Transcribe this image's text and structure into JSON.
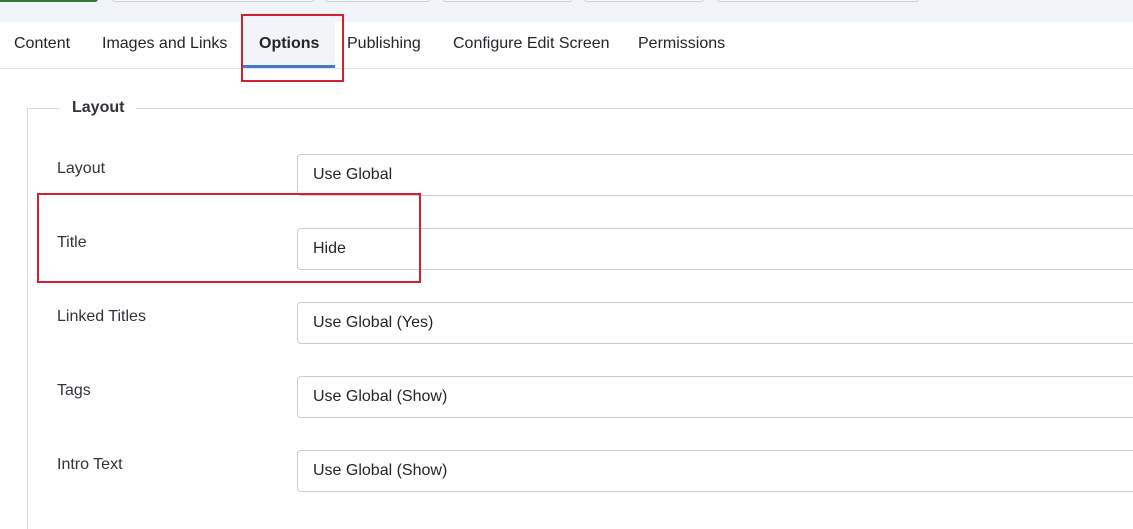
{
  "tabs": [
    {
      "label": "Content"
    },
    {
      "label": "Images and Links"
    },
    {
      "label": "Options",
      "active": true
    },
    {
      "label": "Publishing"
    },
    {
      "label": "Configure Edit Screen"
    },
    {
      "label": "Permissions"
    }
  ],
  "fieldset": {
    "legend": "Layout",
    "fields": [
      {
        "label": "Layout",
        "value": "Use Global"
      },
      {
        "label": "Title",
        "value": "Hide"
      },
      {
        "label": "Linked Titles",
        "value": "Use Global (Yes)"
      },
      {
        "label": "Tags",
        "value": "Use Global (Show)"
      },
      {
        "label": "Intro Text",
        "value": "Use Global (Show)"
      }
    ]
  },
  "colors": {
    "highlight": "#d3202e",
    "tab_active_underline": "#457ac2"
  }
}
